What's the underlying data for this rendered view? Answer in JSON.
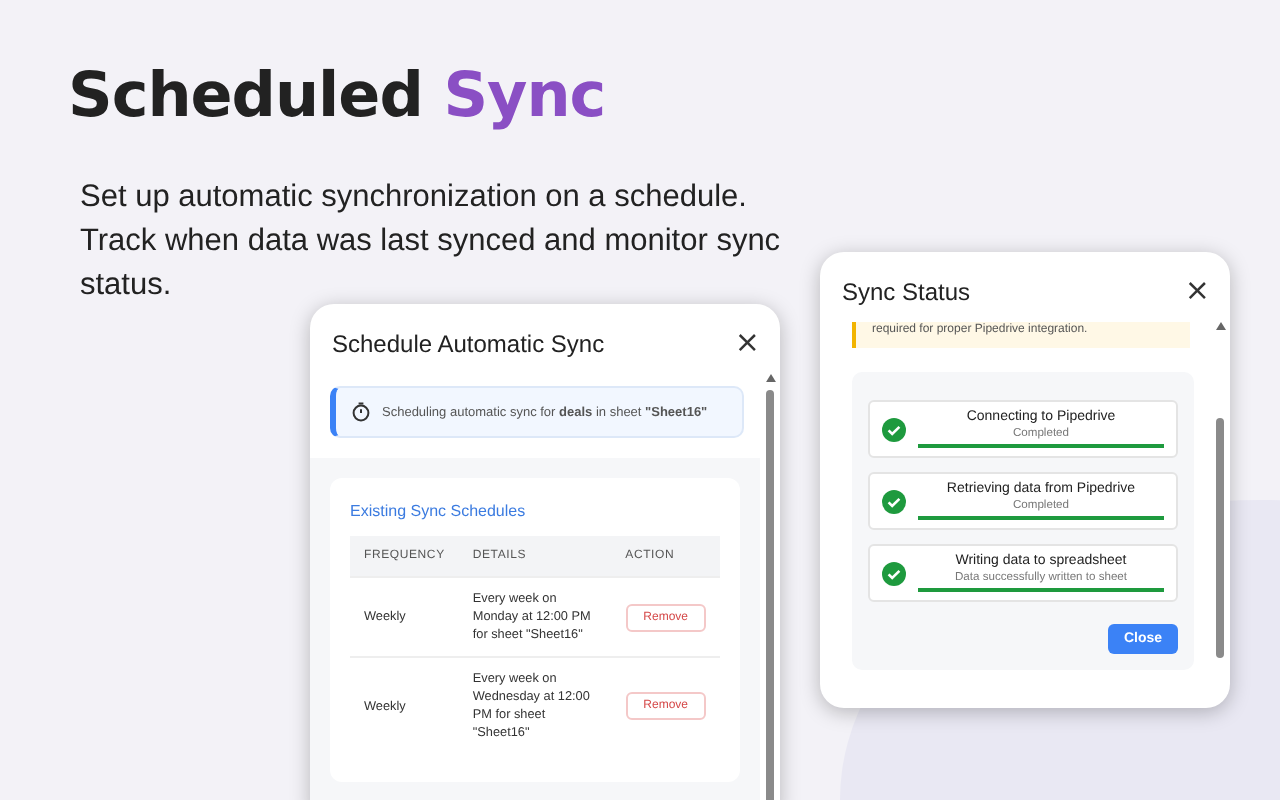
{
  "headline": {
    "text": "Scheduled",
    "accent": "Sync"
  },
  "description": "Set up automatic synchronization on a schedule. Track when data was last synced and monitor sync status.",
  "schedule_dialog": {
    "title": "Schedule Automatic Sync",
    "close": "×",
    "info": "Scheduling automatic sync for **deals** in sheet **\"Sheet16\"**",
    "section_title": "Existing Sync Schedules",
    "columns": [
      "FREQUENCY",
      "DETAILS",
      "ACTION"
    ],
    "rows": [
      {
        "frequency": "Weekly",
        "details": "Every week on Monday at 12:00 PM for sheet \"Sheet16\"",
        "action": "Remove"
      },
      {
        "frequency": "Weekly",
        "details": "Every week on Wednesday at 12:00 PM for sheet \"Sheet16\"",
        "action": "Remove"
      }
    ]
  },
  "status_dialog": {
    "title": "Sync Status",
    "close": "×",
    "warning": "required for proper Pipedrive integration.",
    "steps": [
      {
        "title": "Connecting to Pipedrive",
        "status": "Completed",
        "done": true,
        "level": 1
      },
      {
        "title": "Retrieving data from Pipedrive",
        "status": "Completed",
        "done": true,
        "level": 1
      },
      {
        "title": "Writing data to spreadsheet",
        "status": "Data successfully written to sheet",
        "done": true,
        "level": 1
      }
    ],
    "button": "Close"
  }
}
